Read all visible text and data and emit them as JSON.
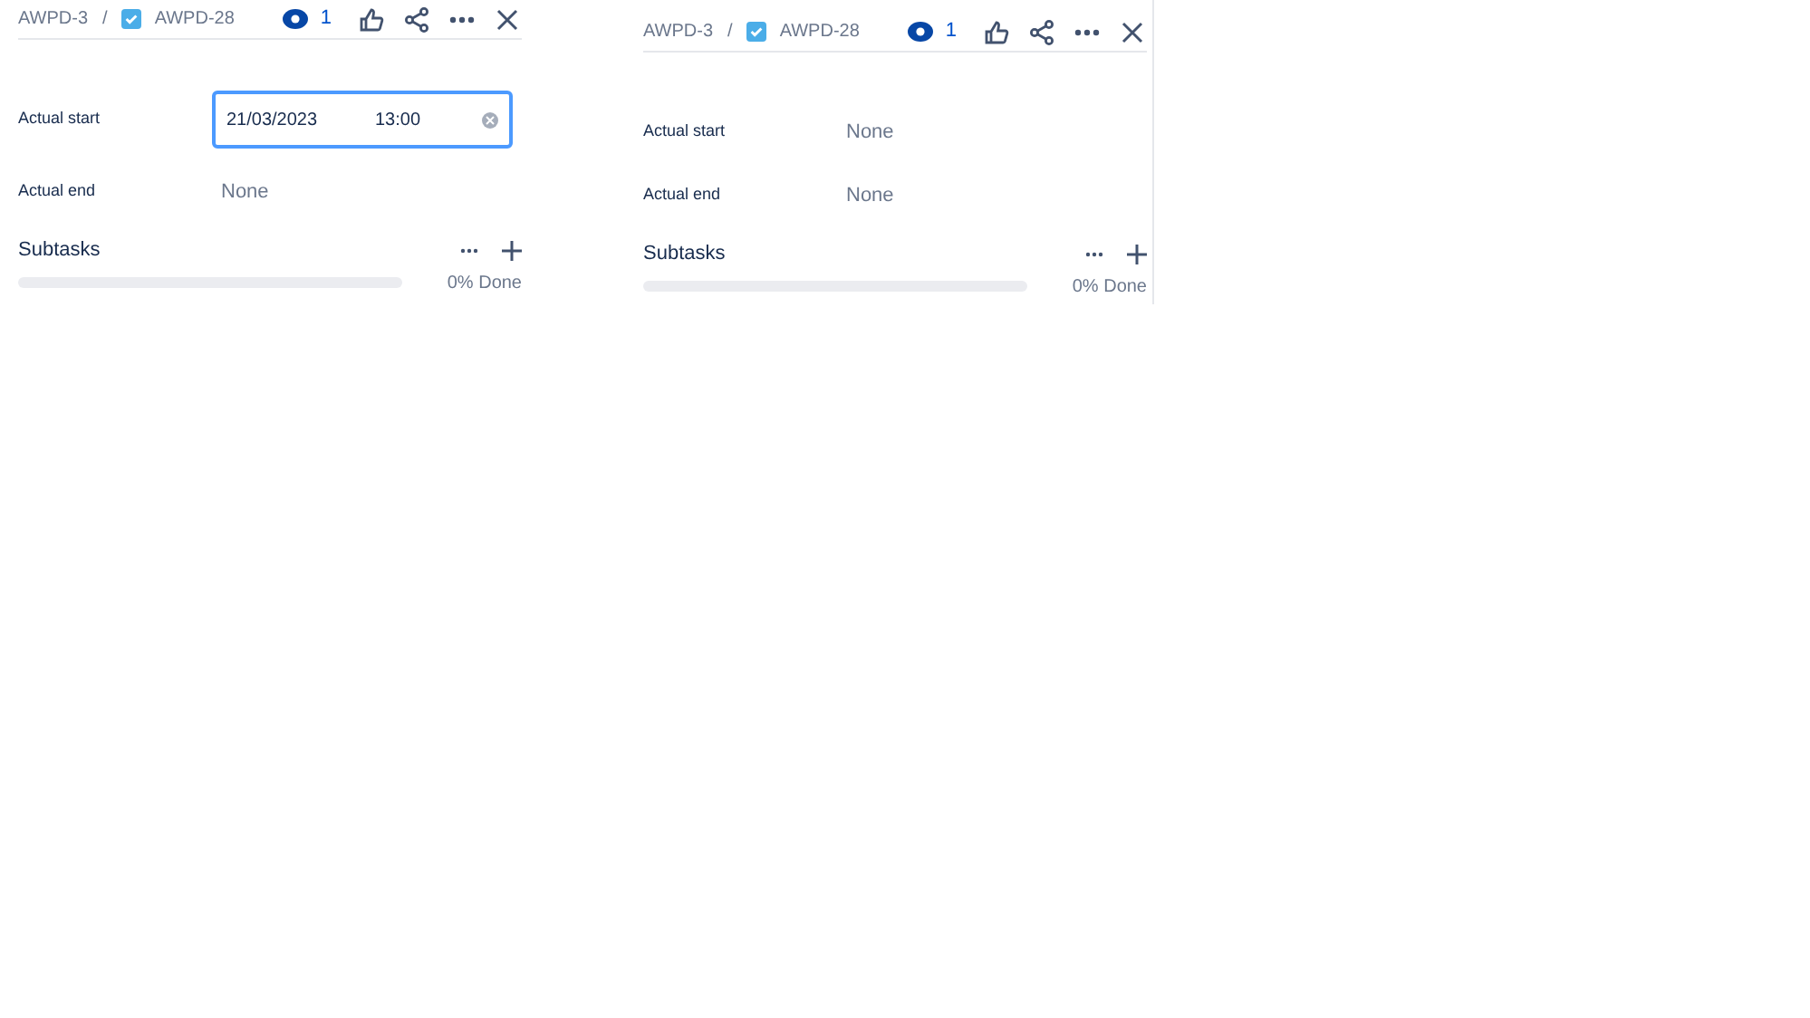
{
  "panels": [
    {
      "breadcrumb": {
        "parent": "AWPD-3",
        "separator": "/",
        "issue": "AWPD-28",
        "issue_checked": true
      },
      "watchers": "1",
      "fields": [
        {
          "kind": "datetime",
          "label": "Actual start",
          "date": "21/03/2023",
          "time": "13:00",
          "focused": true
        },
        {
          "kind": "text",
          "label": "Actual end",
          "value": "None"
        }
      ],
      "subtasks": {
        "title": "Subtasks",
        "level": 0,
        "reading": "0% Done"
      }
    },
    {
      "breadcrumb": {
        "parent": "AWPD-3",
        "separator": "/",
        "issue": "AWPD-28",
        "issue_checked": true
      },
      "watchers": "1",
      "fields": [
        {
          "kind": "text",
          "label": "Actual start",
          "value": "None"
        },
        {
          "kind": "text",
          "label": "Actual end",
          "value": "None"
        }
      ],
      "subtasks": {
        "title": "Subtasks",
        "level": 0,
        "reading": "0% Done"
      }
    }
  ]
}
